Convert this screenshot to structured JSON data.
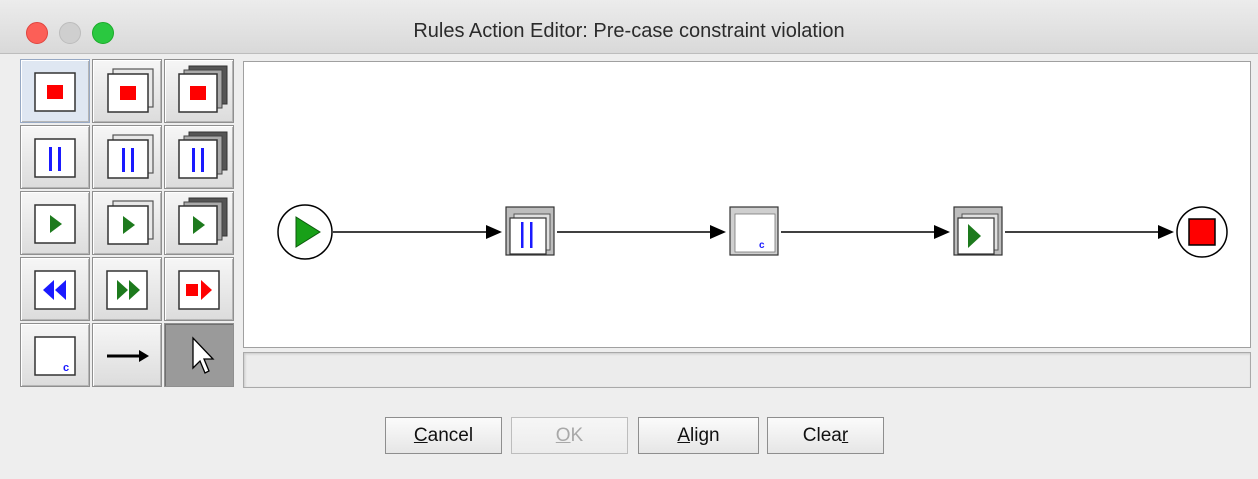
{
  "window": {
    "title": "Rules Action Editor: Pre-case constraint violation"
  },
  "palette": {
    "tools": [
      {
        "icon": "stop-item-icon",
        "tooltip": ""
      },
      {
        "icon": "stop-group-icon",
        "tooltip": ""
      },
      {
        "icon": "stop-multi-icon",
        "tooltip": ""
      },
      {
        "icon": "suspend-item-icon",
        "tooltip": ""
      },
      {
        "icon": "suspend-group-icon",
        "tooltip": ""
      },
      {
        "icon": "suspend-multi-icon",
        "tooltip": ""
      },
      {
        "icon": "resume-item-icon",
        "tooltip": ""
      },
      {
        "icon": "resume-group-icon",
        "tooltip": ""
      },
      {
        "icon": "resume-multi-icon",
        "tooltip": ""
      },
      {
        "icon": "rewind-icon",
        "tooltip": ""
      },
      {
        "icon": "fast-forward-icon",
        "tooltip": ""
      },
      {
        "icon": "stop-and-restart-icon",
        "tooltip": ""
      },
      {
        "icon": "compensate-icon",
        "label": "c"
      },
      {
        "icon": "arrow-connector-icon",
        "tooltip": ""
      },
      {
        "icon": "select-pointer-icon",
        "tooltip": ""
      }
    ],
    "selected_index": 0,
    "active_index": 14
  },
  "diagram": {
    "nodes": [
      {
        "type": "start",
        "icon": "play-icon"
      },
      {
        "type": "suspend-group",
        "icon": "pause-icon"
      },
      {
        "type": "compensate",
        "icon": "compensate-icon",
        "label": "c"
      },
      {
        "type": "resume-group",
        "icon": "play-icon"
      },
      {
        "type": "end",
        "icon": "stop-icon"
      }
    ]
  },
  "status": {
    "text": ""
  },
  "buttons": {
    "cancel": {
      "label": "Cancel",
      "mnemonic": "C",
      "rest": "ancel"
    },
    "ok": {
      "label": "OK",
      "mnemonic": "O",
      "rest": "K",
      "enabled": false
    },
    "align": {
      "label": "Align",
      "mnemonic": "A",
      "rest": "lign"
    },
    "clear": {
      "label": "Clear",
      "pre": "Clea",
      "mnemonic": "r"
    }
  },
  "colors": {
    "stop_red": "#ff0000",
    "suspend_blue": "#1a1aff",
    "resume_green": "#1d7a1d",
    "close": "#fc5f57",
    "maximize": "#2ac840"
  }
}
